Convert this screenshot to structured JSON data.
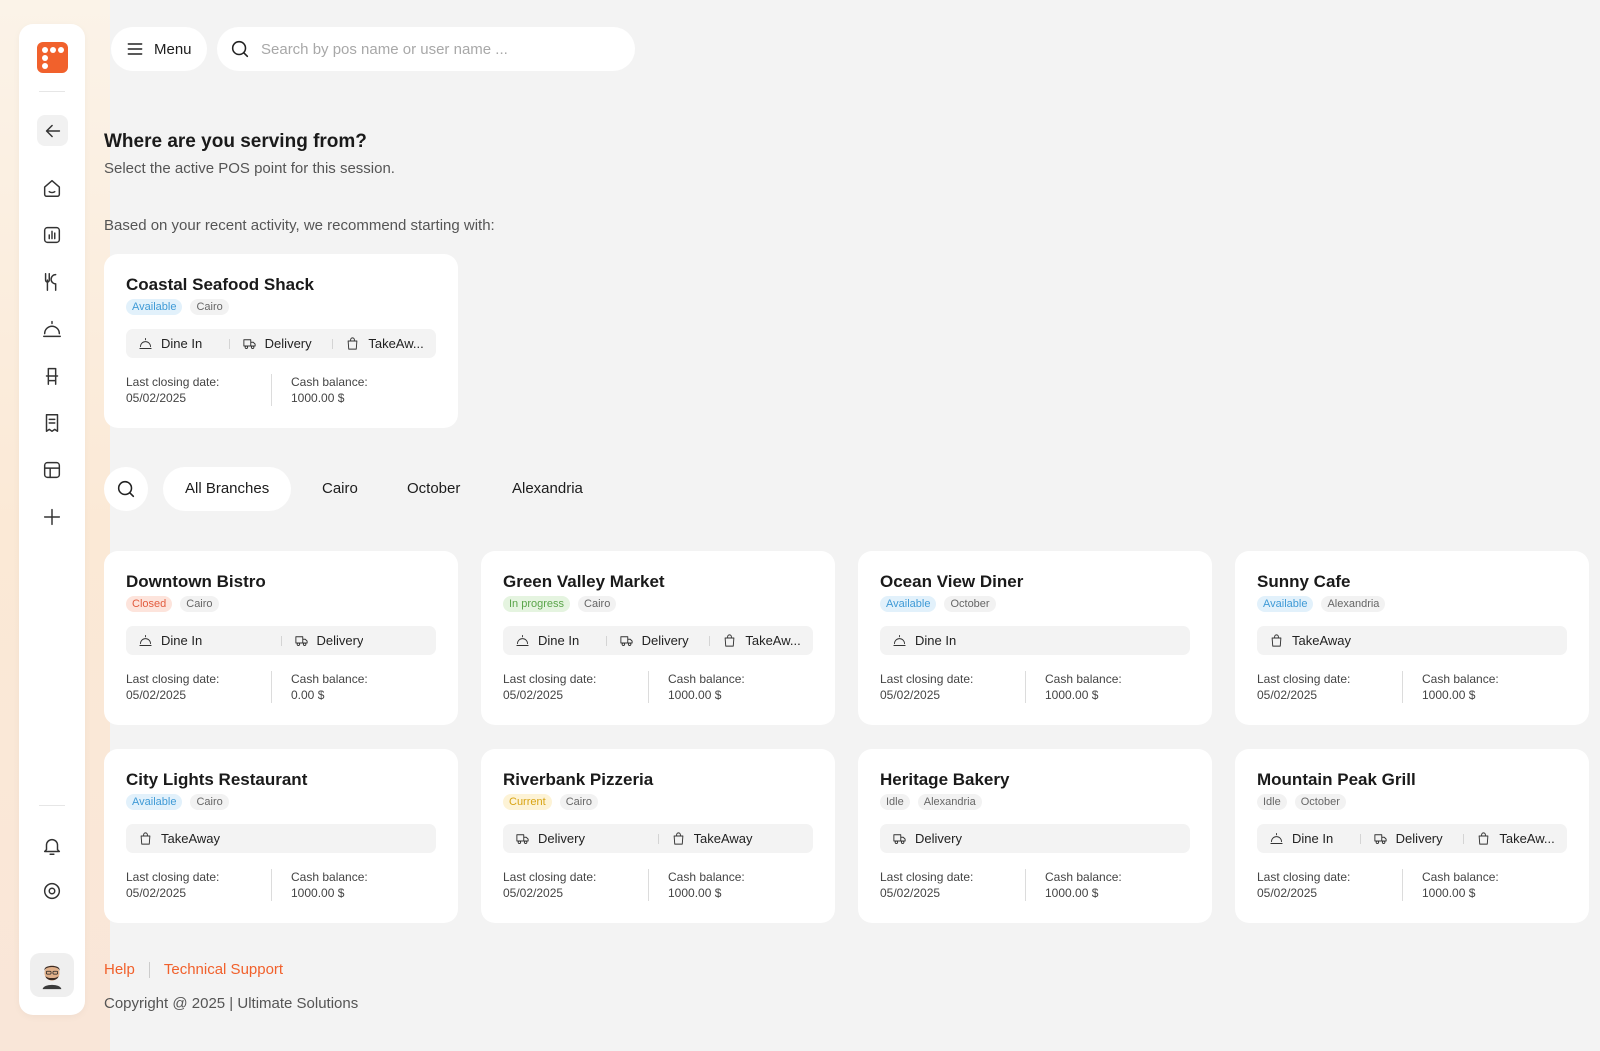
{
  "colors": {
    "accent": "#f1612c",
    "available_bg": "#e2f1fb",
    "available_fg": "#3f9ad6",
    "closed_bg": "#fde4dc",
    "closed_fg": "#e25c3f",
    "progress_bg": "#e5f4e0",
    "progress_fg": "#5aa54a",
    "current_bg": "#fdf3d6",
    "current_fg": "#d8a313",
    "idle_bg": "#f2f2f2",
    "idle_fg": "#666666"
  },
  "topbar": {
    "menu_label": "Menu",
    "search_placeholder": "Search by pos name or user name ..."
  },
  "heading": {
    "title": "Where are you serving from?",
    "subtitle": "Select the active POS point for this session.",
    "recommend": "Based on your recent activity, we recommend starting with:"
  },
  "sidebar": {
    "icons": [
      "back-arrow-icon",
      "home-icon",
      "chart-icon",
      "utensils-icon",
      "cloche-icon",
      "chair-icon",
      "receipt-icon",
      "layout-icon",
      "plus-icon",
      "bell-icon",
      "settings-icon"
    ]
  },
  "recommended": {
    "name": "Coastal Seafood Shack",
    "status": "Available",
    "branch": "Cairo",
    "services": [
      "Dine In",
      "Delivery",
      "TakeAw..."
    ],
    "closing_label": "Last closing date:",
    "closing_date": "05/02/2025",
    "cash_label": "Cash balance:",
    "cash": "1000.00 $"
  },
  "filters": [
    "All Branches",
    "Cairo",
    "October",
    "Alexandria"
  ],
  "cards": [
    {
      "name": "Downtown Bistro",
      "status": "Closed",
      "branch": "Cairo",
      "services": [
        "Dine In",
        "Delivery"
      ],
      "closing_label": "Last closing date:",
      "closing_date": "05/02/2025",
      "cash_label": "Cash balance:",
      "cash": "0.00 $"
    },
    {
      "name": "Green Valley Market",
      "status": "In progress",
      "branch": "Cairo",
      "services": [
        "Dine In",
        "Delivery",
        "TakeAw..."
      ],
      "closing_label": "Last closing date:",
      "closing_date": "05/02/2025",
      "cash_label": "Cash balance:",
      "cash": "1000.00 $"
    },
    {
      "name": "Ocean View Diner",
      "status": "Available",
      "branch": "October",
      "services": [
        "Dine In"
      ],
      "closing_label": "Last closing date:",
      "closing_date": "05/02/2025",
      "cash_label": "Cash balance:",
      "cash": "1000.00 $"
    },
    {
      "name": "Sunny Cafe",
      "status": "Available",
      "branch": "Alexandria",
      "services": [
        "TakeAway"
      ],
      "closing_label": "Last closing date:",
      "closing_date": "05/02/2025",
      "cash_label": "Cash balance:",
      "cash": "1000.00 $"
    },
    {
      "name": "City Lights Restaurant",
      "status": "Available",
      "branch": "Cairo",
      "services": [
        "TakeAway"
      ],
      "closing_label": "Last closing date:",
      "closing_date": "05/02/2025",
      "cash_label": "Cash balance:",
      "cash": "1000.00 $"
    },
    {
      "name": "Riverbank Pizzeria",
      "status": "Current",
      "branch": "Cairo",
      "services": [
        "Delivery",
        "TakeAway"
      ],
      "closing_label": "Last closing date:",
      "closing_date": "05/02/2025",
      "cash_label": "Cash balance:",
      "cash": "1000.00 $"
    },
    {
      "name": "Heritage Bakery",
      "status": "Idle",
      "branch": "Alexandria",
      "services": [
        "Delivery"
      ],
      "closing_label": "Last closing date:",
      "closing_date": "05/02/2025",
      "cash_label": "Cash balance:",
      "cash": "1000.00 $"
    },
    {
      "name": "Mountain Peak Grill",
      "status": "Idle",
      "branch": "October",
      "services": [
        "Dine In",
        "Delivery",
        "TakeAw..."
      ],
      "closing_label": "Last closing date:",
      "closing_date": "05/02/2025",
      "cash_label": "Cash balance:",
      "cash": "1000.00 $"
    }
  ],
  "footer": {
    "help": "Help",
    "support": "Technical Support",
    "copyright": "Copyright @ 2025 | Ultimate Solutions"
  }
}
